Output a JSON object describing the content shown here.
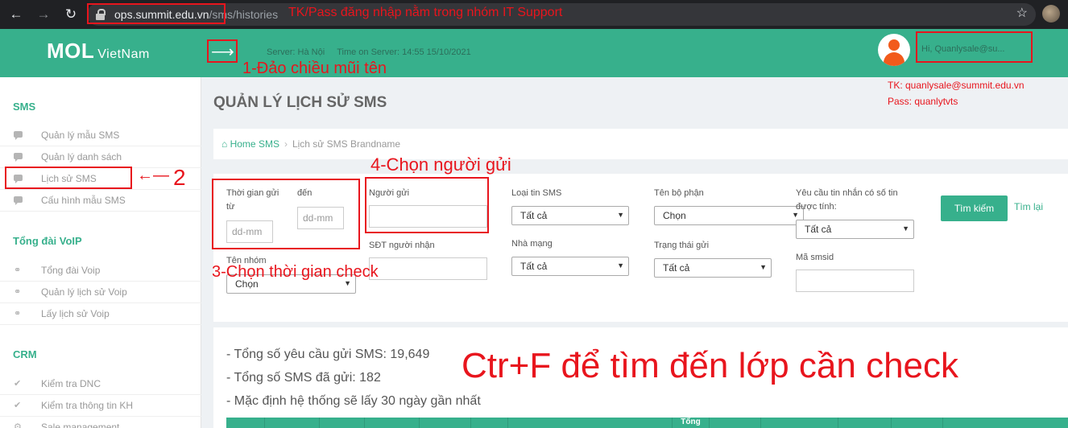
{
  "browser": {
    "url_host": "ops.summit.edu.vn",
    "url_path": "/sms/histories"
  },
  "header": {
    "logo_main": "MOL",
    "logo_sub": "VietNam",
    "server": "Server: Hà Nội",
    "time": "Time on Server: 14:55 15/10/2021",
    "greeting": "Hi, Quanlysale@su..."
  },
  "sidebar": {
    "sections": [
      {
        "title": "SMS",
        "items": [
          "Quản lý mẫu SMS",
          "Quản lý danh sách",
          "Lịch sử SMS",
          "Cấu hình mẫu SMS"
        ]
      },
      {
        "title": "Tổng đài VoIP",
        "items": [
          "Tổng đài Voip",
          "Quản lý lịch sử Voip",
          "Lấy lịch sử Voip"
        ]
      },
      {
        "title": "CRM",
        "items": [
          "Kiểm tra DNC",
          "Kiểm tra thông tin KH",
          "Sale management"
        ]
      }
    ]
  },
  "main": {
    "title": "QUẢN LÝ LỊCH SỬ SMS",
    "breadcrumb_home": "Home SMS",
    "breadcrumb_current": "Lịch sử SMS Brandname"
  },
  "filters": {
    "time_from_label": "Thời gian gửi từ",
    "time_to_label": "đến",
    "date_placeholder": "dd-mm",
    "sender_label": "Người gửi",
    "receiver_label": "SĐT người nhận",
    "group_label": "Tên nhóm",
    "group_value": "Chọn",
    "sms_type_label": "Loại tin SMS",
    "sms_type_value": "Tất cả",
    "carrier_label": "Nhà mạng",
    "carrier_value": "Tất cả",
    "department_label": "Tên bộ phận",
    "department_value": "Chọn",
    "status_label": "Trạng thái gửi",
    "status_value": "Tất cả",
    "chargeable_label": "Yêu cầu tin nhắn có số tin được tính:",
    "chargeable_value": "Tất cả",
    "smsid_label": "Mã smsid",
    "search_button": "Tìm kiếm",
    "reset_link": "Tìm lại"
  },
  "stats": {
    "total_requests": "- Tổng số yêu cầu gửi SMS: 19,649",
    "total_sent": "- Tổng số SMS đã gửi: 182",
    "default_note": "- Mặc định hệ thống sẽ lấy 30 ngày gần nhất"
  },
  "table": {
    "partial_header": "Tổng"
  },
  "annotations": {
    "login_note": "TK/Pass đăng nhập nằm trong nhóm IT Support",
    "step1": "1-Đảo chiều mũi tên",
    "step2": "2",
    "step3": "3-Chọn thời gian check",
    "step4": "4-Chọn người gửi",
    "credential_user": "TK: quanlysale@summit.edu.vn",
    "credential_pass": "Pass: quanlytvts",
    "ctrl_f": "Ctr+F để tìm đến lớp cần check"
  },
  "colors": {
    "brand": "#37b08c",
    "annotation": "#e8151d"
  }
}
